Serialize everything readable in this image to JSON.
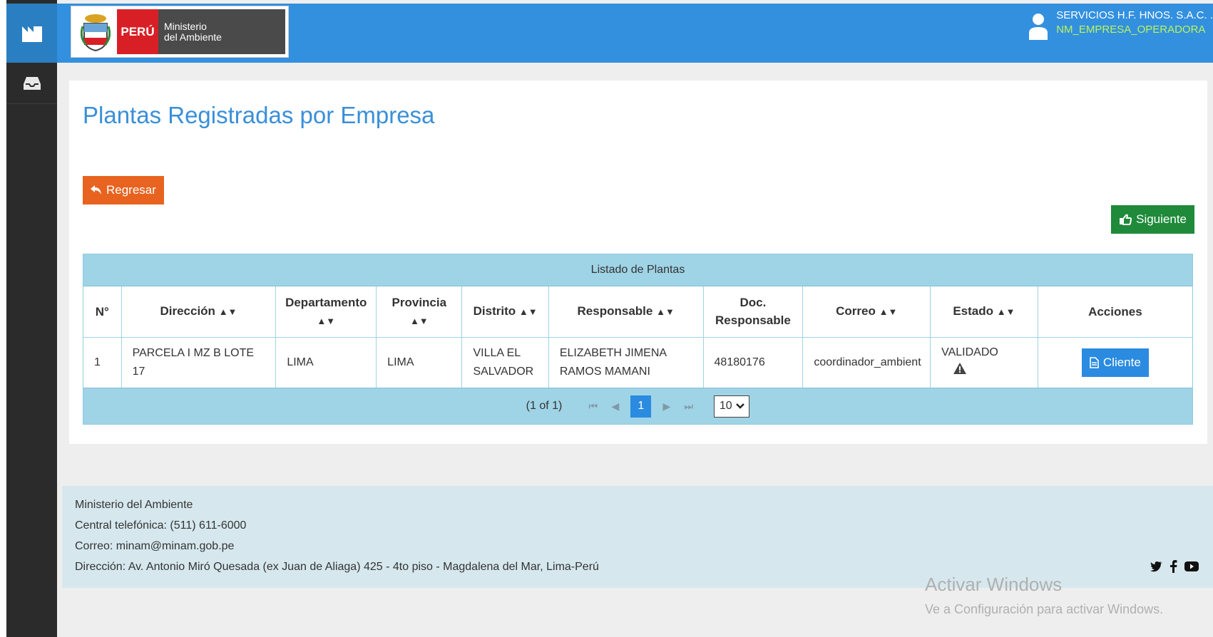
{
  "header": {
    "brand_country": "PERÚ",
    "brand_ministry_line1": "Ministerio",
    "brand_ministry_line2": "del Ambiente",
    "user_company": "SERVICIOS H.F. HNOS. S.A.C. .",
    "user_role": "NM_EMPRESA_OPERADORA"
  },
  "page": {
    "title": "Plantas Registradas por Empresa",
    "back_label": "Regresar",
    "next_label": "Siguiente"
  },
  "grid": {
    "caption": "Listado de Plantas",
    "columns": [
      "N°",
      "Dirección",
      "Departamento",
      "Provincia",
      "Distrito",
      "Responsable",
      "Doc. Responsable",
      "Correo",
      "Estado",
      "Acciones"
    ],
    "rows": [
      {
        "n": "1",
        "direccion": "PARCELA I MZ B LOTE 17",
        "departamento": "LIMA",
        "provincia": "LIMA",
        "distrito": "VILLA EL SALVADOR",
        "responsable": "ELIZABETH JIMENA RAMOS MAMANI",
        "doc": "48180176",
        "correo": "coordinador_ambient",
        "estado": "VALIDADO",
        "action_label": "Cliente"
      }
    ],
    "paginator": {
      "summary": "(1 of 1)",
      "current_page": "1",
      "rows_per_page": "10"
    }
  },
  "footer": {
    "line1": "Ministerio del Ambiente",
    "line2": "Central telefónica: (511) 611-6000",
    "line3": "Correo: minam@minam.gob.pe",
    "line4": "Dirección: Av. Antonio Miró Quesada (ex Juan de Aliaga) 425 - 4to piso - Magdalena del Mar, Lima-Perú"
  },
  "watermark": {
    "title": "Activar Windows",
    "subtitle": "Ve a Configuración para activar Windows."
  },
  "colors": {
    "topbar": "#3390df",
    "title": "#3a8fd8",
    "back_button": "#e8631f",
    "next_button": "#1e8a3a",
    "grid_header": "#9fd3e6"
  }
}
